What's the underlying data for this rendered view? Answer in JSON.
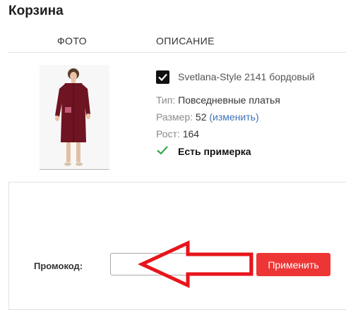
{
  "page": {
    "title": "Корзина"
  },
  "table": {
    "photo_header": "ФОТО",
    "description_header": "ОПИСАНИЕ"
  },
  "product": {
    "checked": true,
    "name": "Svetlana-Style 2141 бордовый",
    "type_label": "Тип:",
    "type_value": "Повседневные платья",
    "size_label": "Размер:",
    "size_value": "52",
    "size_change_link": "(изменить)",
    "height_label": "Рост:",
    "height_value": "164",
    "fitting_text": "Есть примерка",
    "dress_color": "#6e1422"
  },
  "promo": {
    "label": "Промокод:",
    "input_value": "",
    "apply_button": "Применить",
    "button_color": "#ee3535"
  },
  "annotation": {
    "arrow_color": "#e8141b"
  }
}
